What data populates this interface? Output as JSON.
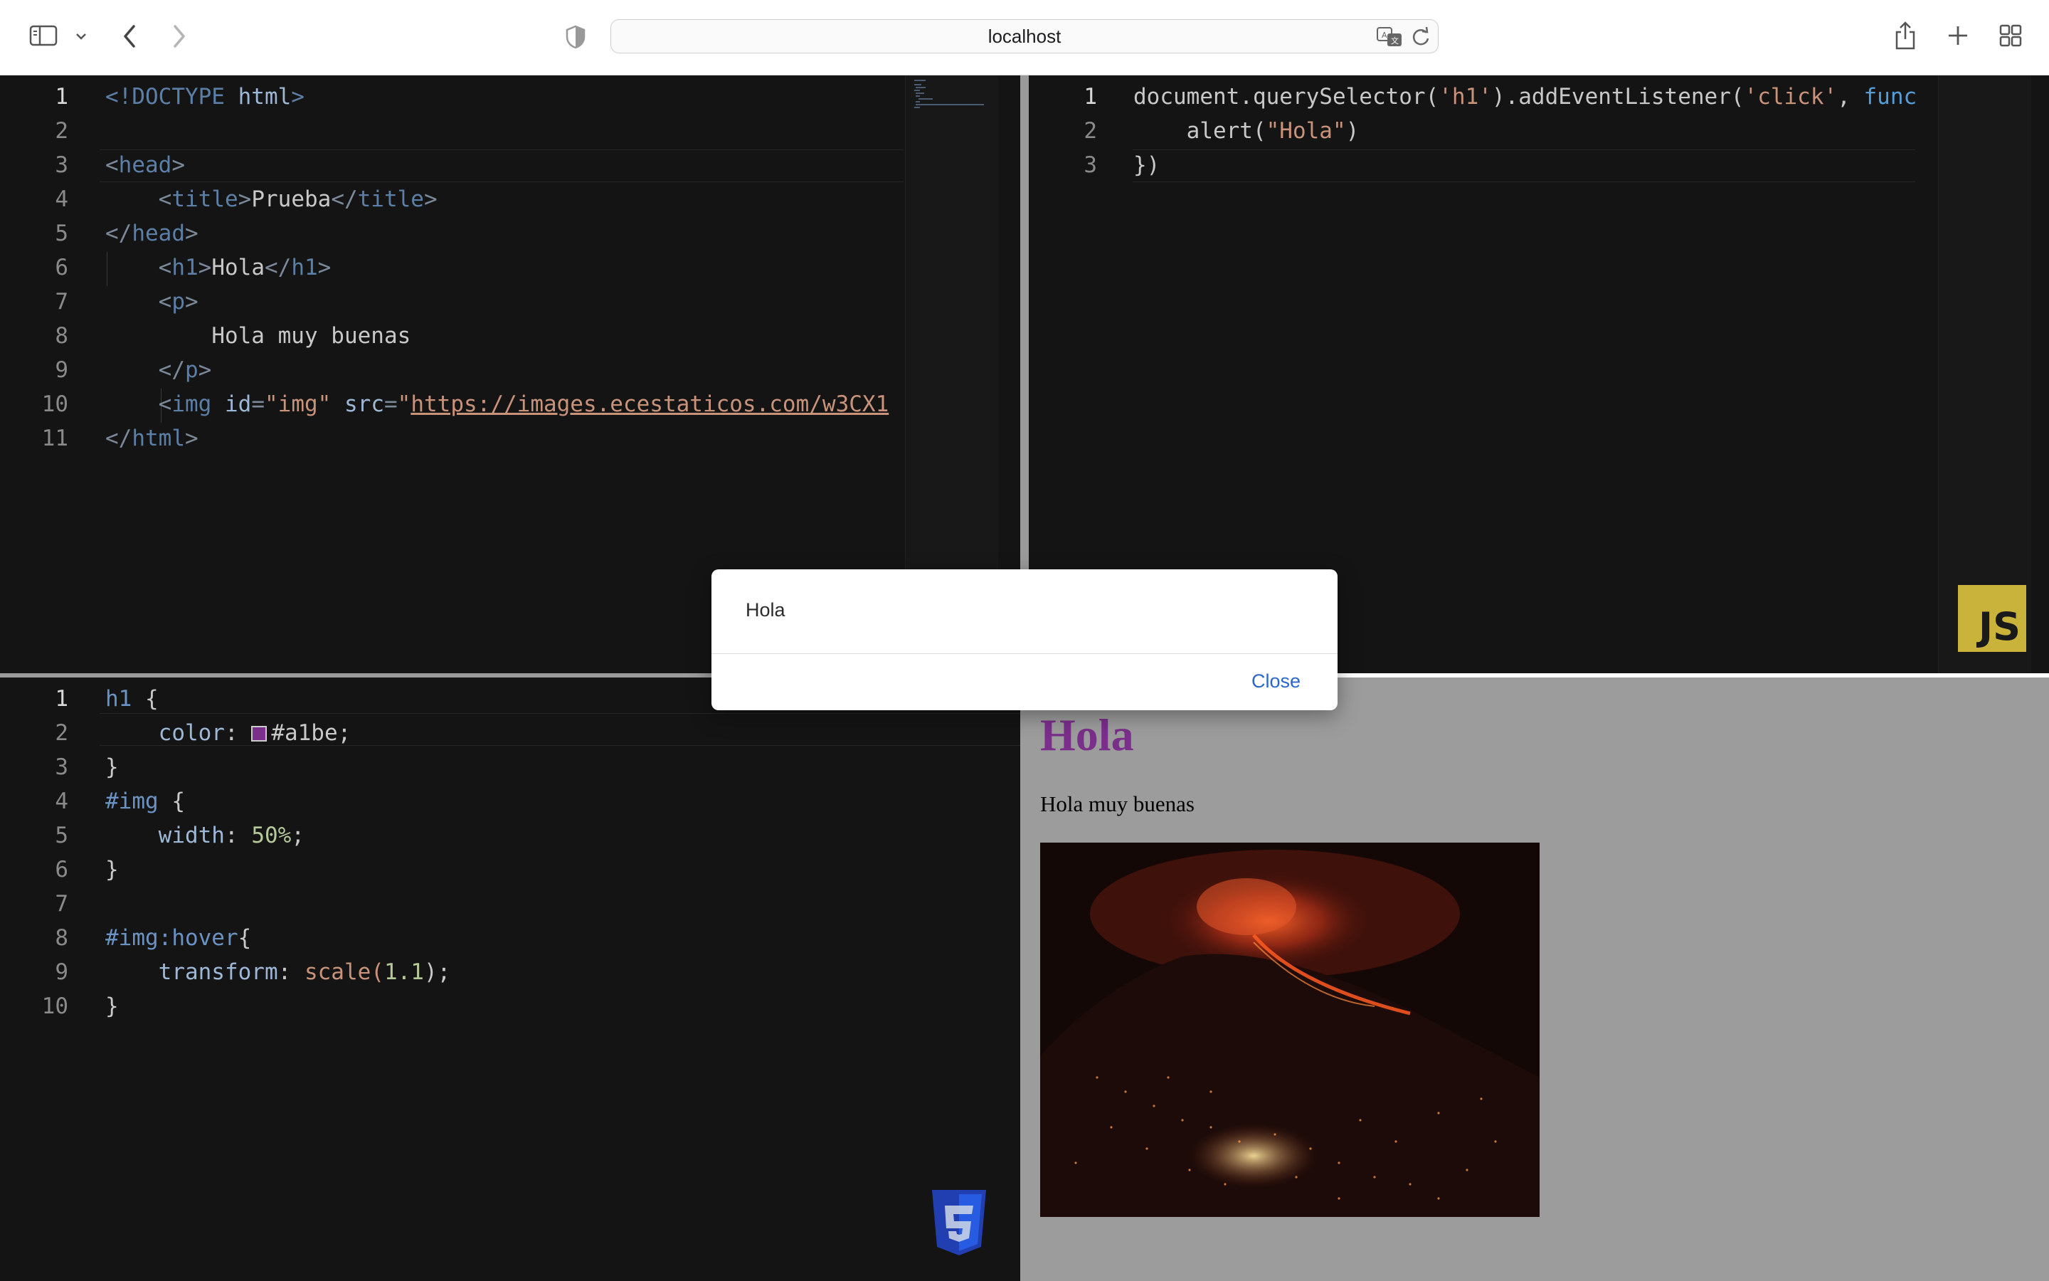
{
  "browser": {
    "address": "localhost",
    "icons": {
      "sidebar": "sidebar-icon",
      "chevron": "chevron-down-icon",
      "back": "back-arrow-icon",
      "forward": "forward-arrow-icon",
      "shield": "privacy-shield-icon",
      "translate": "translate-icon",
      "reload": "reload-icon",
      "share": "share-icon",
      "new_tab": "plus-icon",
      "tab_overview": "tab-overview-icon"
    }
  },
  "html_editor": {
    "line_numbers": [
      "1",
      "2",
      "3",
      "4",
      "5",
      "6",
      "7",
      "8",
      "9",
      "10",
      "11"
    ],
    "lines": [
      [
        {
          "t": "<!DOCTYPE ",
          "c": "tok-doctype"
        },
        {
          "t": "html",
          "c": "tok-attr"
        },
        {
          "t": ">",
          "c": "tok-doctype"
        }
      ],
      [],
      [
        {
          "t": "<",
          "c": "tok-punct"
        },
        {
          "t": "head",
          "c": "tok-tag"
        },
        {
          "t": ">",
          "c": "tok-punct"
        }
      ],
      [
        {
          "t": "    "
        },
        {
          "t": "<",
          "c": "tok-punct"
        },
        {
          "t": "title",
          "c": "tok-tag"
        },
        {
          "t": ">",
          "c": "tok-punct"
        },
        {
          "t": "Prueba",
          "c": "tok-text"
        },
        {
          "t": "</",
          "c": "tok-punct"
        },
        {
          "t": "title",
          "c": "tok-tag"
        },
        {
          "t": ">",
          "c": "tok-punct"
        }
      ],
      [
        {
          "t": "</",
          "c": "tok-punct"
        },
        {
          "t": "head",
          "c": "tok-tag"
        },
        {
          "t": ">",
          "c": "tok-punct"
        }
      ],
      [
        {
          "t": "    "
        },
        {
          "t": "<",
          "c": "tok-punct"
        },
        {
          "t": "h1",
          "c": "tok-tag"
        },
        {
          "t": ">",
          "c": "tok-punct"
        },
        {
          "t": "Hola",
          "c": "tok-text"
        },
        {
          "t": "</",
          "c": "tok-punct"
        },
        {
          "t": "h1",
          "c": "tok-tag"
        },
        {
          "t": ">",
          "c": "tok-punct"
        }
      ],
      [
        {
          "t": "    "
        },
        {
          "t": "<",
          "c": "tok-punct"
        },
        {
          "t": "p",
          "c": "tok-tag"
        },
        {
          "t": ">",
          "c": "tok-punct"
        }
      ],
      [
        {
          "t": "        "
        },
        {
          "t": "Hola muy buenas",
          "c": "tok-text"
        }
      ],
      [
        {
          "t": "    "
        },
        {
          "t": "</",
          "c": "tok-punct"
        },
        {
          "t": "p",
          "c": "tok-tag"
        },
        {
          "t": ">",
          "c": "tok-punct"
        }
      ],
      [
        {
          "t": "    "
        },
        {
          "t": "<",
          "c": "tok-punct"
        },
        {
          "t": "img",
          "c": "tok-tag"
        },
        {
          "t": " "
        },
        {
          "t": "id",
          "c": "tok-attr"
        },
        {
          "t": "=",
          "c": "tok-punct"
        },
        {
          "t": "\"img\"",
          "c": "tok-str"
        },
        {
          "t": " "
        },
        {
          "t": "src",
          "c": "tok-attr"
        },
        {
          "t": "=",
          "c": "tok-punct"
        },
        {
          "t": "\"",
          "c": "tok-str"
        },
        {
          "t": "https://images.ecestaticos.com/w3CX1",
          "c": "tok-strlink"
        }
      ],
      [
        {
          "t": "</",
          "c": "tok-punct"
        },
        {
          "t": "html",
          "c": "tok-tag"
        },
        {
          "t": ">",
          "c": "tok-punct"
        }
      ]
    ]
  },
  "js_editor": {
    "line_numbers": [
      "1",
      "2",
      "3"
    ],
    "lines": [
      [
        {
          "t": "document.querySelector(",
          "c": "tok-js"
        },
        {
          "t": "'h1'",
          "c": "tok-str"
        },
        {
          "t": ").addEventListener(",
          "c": "tok-js"
        },
        {
          "t": "'click'",
          "c": "tok-str"
        },
        {
          "t": ", ",
          "c": "tok-js"
        },
        {
          "t": "func",
          "c": "tok-kw"
        }
      ],
      [
        {
          "t": "    alert(",
          "c": "tok-js"
        },
        {
          "t": "\"Hola\"",
          "c": "tok-str"
        },
        {
          "t": ")",
          "c": "tok-js"
        }
      ],
      [
        {
          "t": "})",
          "c": "tok-js"
        }
      ]
    ],
    "badge": "JS"
  },
  "css_editor": {
    "line_numbers": [
      "1",
      "2",
      "3",
      "4",
      "5",
      "6",
      "7",
      "8",
      "9",
      "10"
    ],
    "lines": [
      [
        {
          "t": "h1",
          "c": "tok-sel"
        },
        {
          "t": " {",
          "c": "tok-text"
        }
      ],
      [
        {
          "t": "    "
        },
        {
          "t": "color",
          "c": "tok-prop"
        },
        {
          "t": ": ",
          "c": "tok-text"
        },
        {
          "t": "SWATCH"
        },
        {
          "t": "#a1be",
          "c": "tok-text"
        },
        {
          "t": ";",
          "c": "tok-text"
        }
      ],
      [
        {
          "t": "}",
          "c": "tok-text"
        }
      ],
      [
        {
          "t": "#img",
          "c": "tok-sel"
        },
        {
          "t": " {",
          "c": "tok-text"
        }
      ],
      [
        {
          "t": "    "
        },
        {
          "t": "width",
          "c": "tok-prop"
        },
        {
          "t": ": ",
          "c": "tok-text"
        },
        {
          "t": "50%",
          "c": "tok-num"
        },
        {
          "t": ";",
          "c": "tok-text"
        }
      ],
      [
        {
          "t": "}",
          "c": "tok-text"
        }
      ],
      [],
      [
        {
          "t": "#img:hover",
          "c": "tok-sel"
        },
        {
          "t": "{",
          "c": "tok-text"
        }
      ],
      [
        {
          "t": "    "
        },
        {
          "t": "transform",
          "c": "tok-prop"
        },
        {
          "t": ": ",
          "c": "tok-text"
        },
        {
          "t": "scale(",
          "c": "tok-fn"
        },
        {
          "t": "1.1",
          "c": "tok-num"
        },
        {
          "t": ");",
          "c": "tok-text"
        }
      ],
      [
        {
          "t": "}",
          "c": "tok-text"
        }
      ]
    ],
    "swatch_color": "#7a2f8a",
    "badge": "css3-shield-icon"
  },
  "preview": {
    "heading": "Hola",
    "paragraph": "Hola muy buenas",
    "image": "volcano-eruption-night-image"
  },
  "dialog": {
    "message": "Hola",
    "close_label": "Close"
  },
  "colors": {
    "editor_bg": "#141414",
    "preview_bg": "#9c9c9c",
    "heading_color": "#7a2f8a",
    "js_badge": "#c9b33a",
    "link_blue": "#2a67c9"
  }
}
